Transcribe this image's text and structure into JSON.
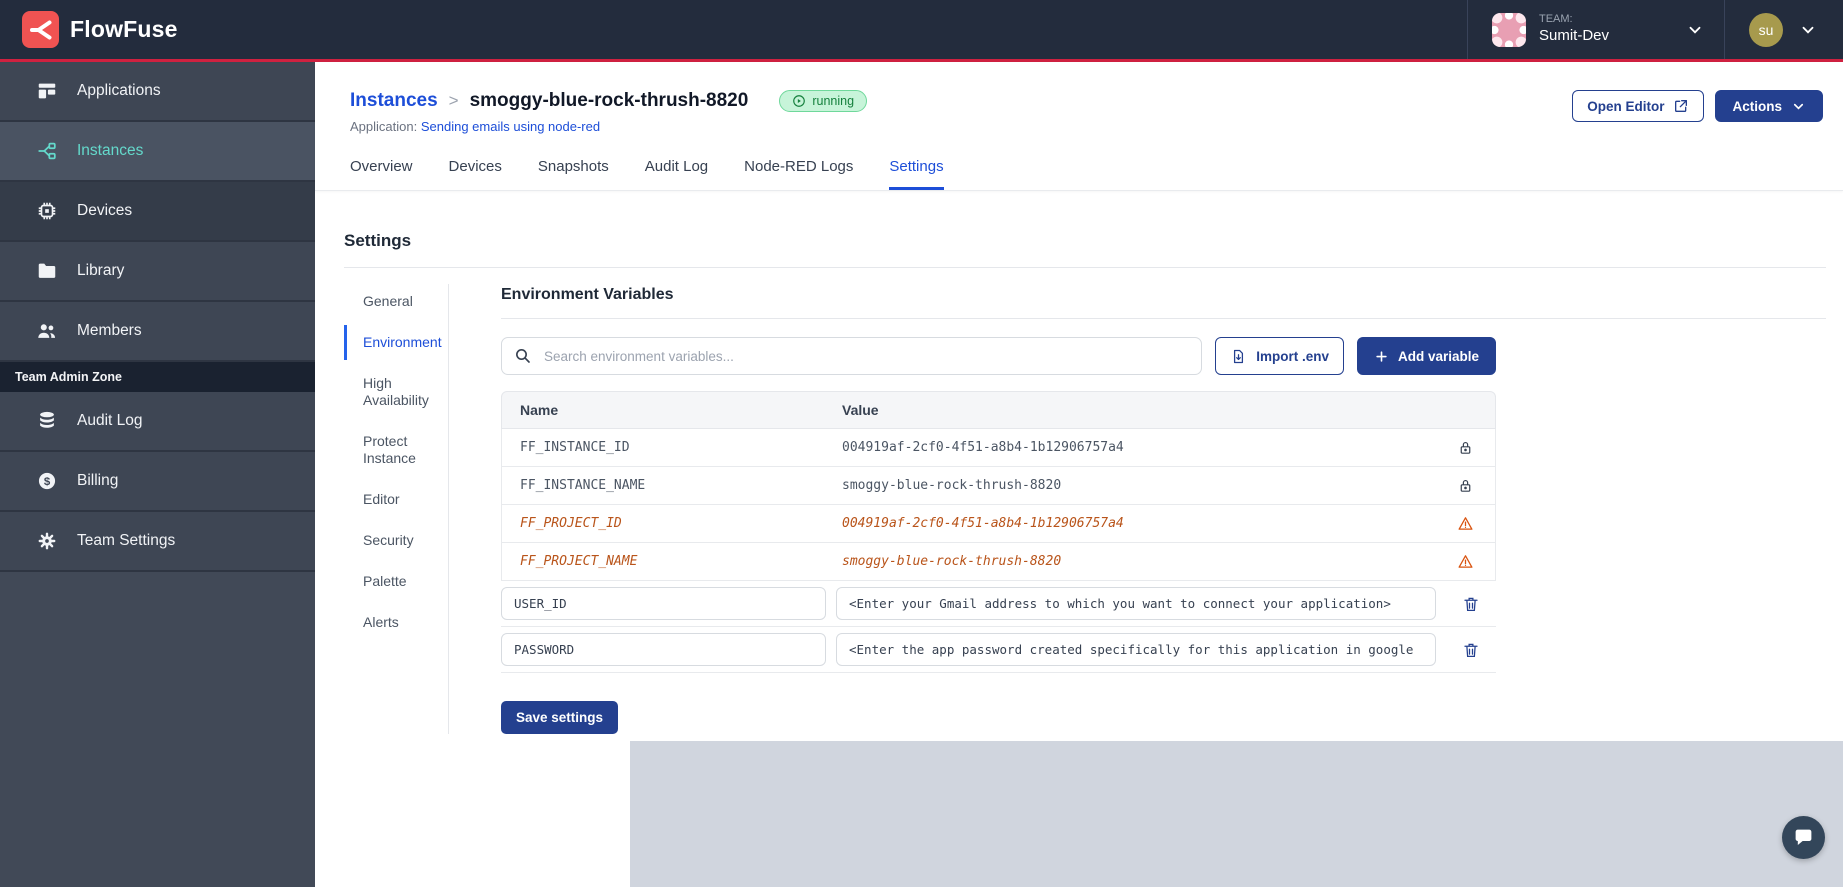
{
  "header": {
    "brand": "FlowFuse",
    "team_label": "TEAM:",
    "team_name": "Sumit-Dev",
    "user_initials": "su"
  },
  "sidebar": {
    "items": [
      {
        "label": "Applications"
      },
      {
        "label": "Instances"
      },
      {
        "label": "Devices"
      },
      {
        "label": "Library"
      },
      {
        "label": "Members"
      }
    ],
    "active_item": "Instances",
    "admin_zone_label": "Team Admin Zone",
    "admin_items": [
      {
        "label": "Audit Log"
      },
      {
        "label": "Billing"
      },
      {
        "label": "Team Settings"
      }
    ]
  },
  "page": {
    "breadcrumb_root": "Instances",
    "breadcrumb_sep": ">",
    "instance_name": "smoggy-blue-rock-thrush-8820",
    "status": "running",
    "application_label": "Application:",
    "application_name": "Sending emails using node-red",
    "open_editor_label": "Open Editor",
    "actions_label": "Actions",
    "tabs": [
      "Overview",
      "Devices",
      "Snapshots",
      "Audit Log",
      "Node-RED Logs",
      "Settings"
    ],
    "active_tab": "Settings"
  },
  "settings": {
    "title": "Settings",
    "nav": [
      "General",
      "Environment",
      "High Availability",
      "Protect Instance",
      "Editor",
      "Security",
      "Palette",
      "Alerts"
    ],
    "active_nav": "Environment"
  },
  "env": {
    "title": "Environment Variables",
    "search_placeholder": "Search environment variables...",
    "import_label": "Import .env",
    "add_label": "Add variable",
    "save_label": "Save settings",
    "table": {
      "columns": {
        "name": "Name",
        "value": "Value"
      },
      "rows": [
        {
          "name": "FF_INSTANCE_ID",
          "value": "004919af-2cf0-4f51-a8b4-1b12906757a4",
          "state": "locked"
        },
        {
          "name": "FF_INSTANCE_NAME",
          "value": "smoggy-blue-rock-thrush-8820",
          "state": "locked"
        },
        {
          "name": "FF_PROJECT_ID",
          "value": "004919af-2cf0-4f51-a8b4-1b12906757a4",
          "state": "deprecated"
        },
        {
          "name": "FF_PROJECT_NAME",
          "value": "smoggy-blue-rock-thrush-8820",
          "state": "deprecated"
        }
      ],
      "editable_rows": [
        {
          "name": "USER_ID",
          "value": "<Enter your Gmail address to which you want to connect your application>"
        },
        {
          "name": "PASSWORD",
          "value": "<Enter the app password created specifically for this application in google"
        }
      ]
    }
  },
  "colors": {
    "topbar_bg": "#232c3d",
    "accent_red": "#cf2140",
    "logo_red": "#f05352",
    "sidebar_item_bg": "#3e4654",
    "sidebar_active_teal": "#64d9cb",
    "link_blue": "#1d4ed8",
    "button_navy": "#24408f",
    "running_badge_bg": "#c7f4d9",
    "running_badge_text": "#15803d",
    "deprecated_orange": "#b9541a",
    "warning_icon_orange": "#d9530f",
    "footer_grey": "#d0d5de",
    "chat_bubble_bg": "#33465a"
  }
}
